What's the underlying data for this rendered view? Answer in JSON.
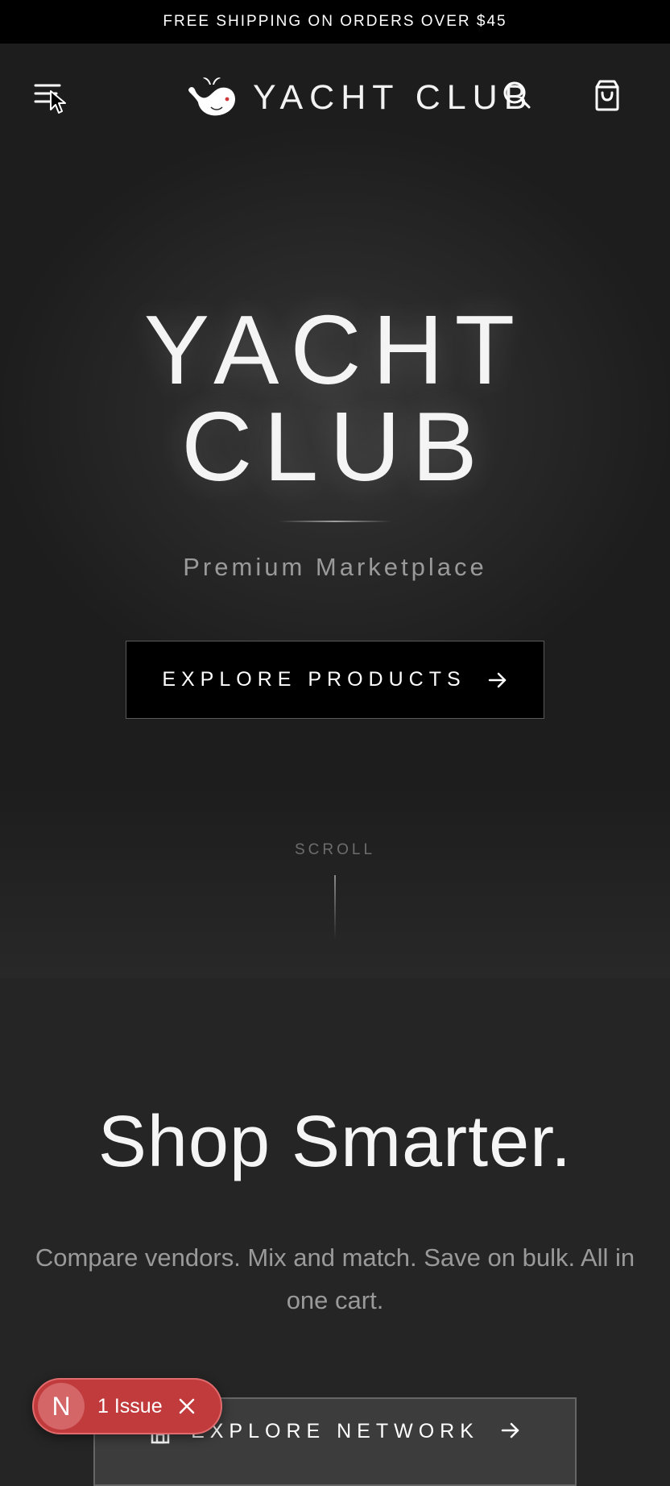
{
  "promo": {
    "text": "FREE SHIPPING ON ORDERS OVER $45"
  },
  "header": {
    "brand": "YACHT CLUB",
    "menu_icon": "menu-icon",
    "logo_icon": "whale-icon",
    "search_icon": "search-icon",
    "cart_icon": "shopping-bag-icon"
  },
  "hero": {
    "title_line1": "YACHT",
    "title_line2": "CLUB",
    "subtitle": "Premium Marketplace",
    "cta_label": "EXPLORE PRODUCTS",
    "scroll_label": "SCROLL"
  },
  "section": {
    "title": "Shop Smarter.",
    "text": "Compare vendors. Mix and match. Save on bulk. All in one cart.",
    "cta_label": "EXPLORE NETWORK"
  },
  "dev_overlay": {
    "avatar_letter": "N",
    "issues_label": "1 Issue"
  },
  "colors": {
    "background": "#252525",
    "promo_bar": "#000000",
    "issue_badge": "#c13b3d",
    "accent_dot": "#d0383a"
  }
}
